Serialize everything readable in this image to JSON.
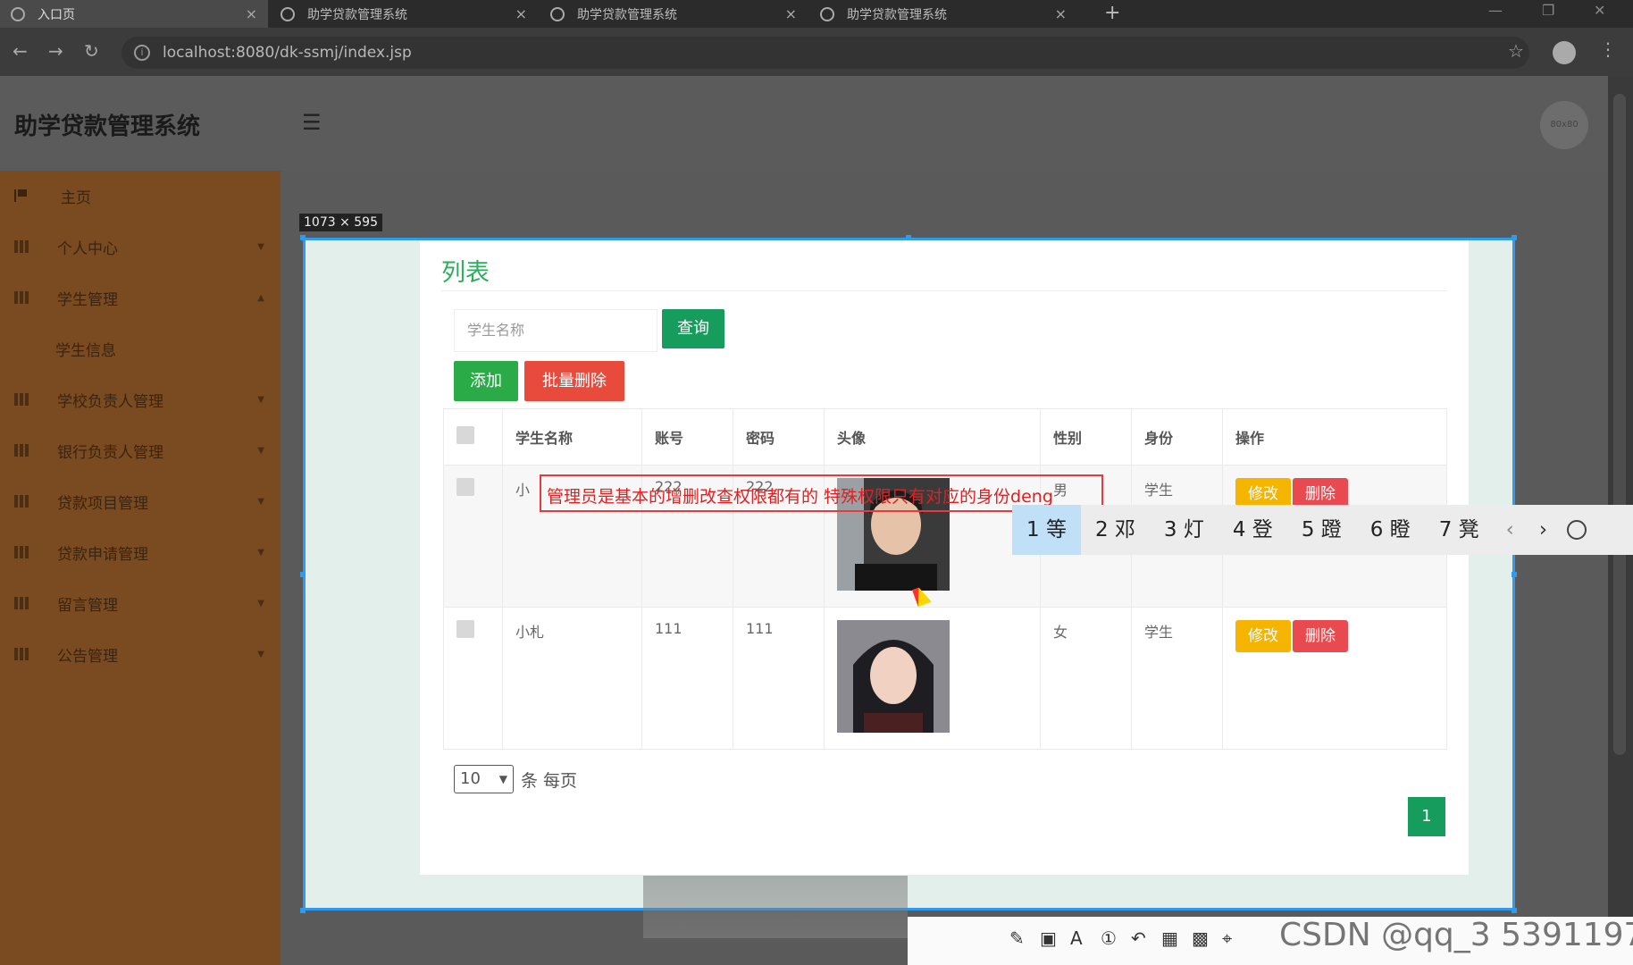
{
  "browser": {
    "tabs": [
      {
        "title": "入口页",
        "close": "×"
      },
      {
        "title": "助学贷款管理系统",
        "close": "×"
      },
      {
        "title": "助学贷款管理系统",
        "close": "×"
      },
      {
        "title": "助学贷款管理系统",
        "close": "×"
      }
    ],
    "new_tab": "+",
    "url": "localhost:8080/dk-ssmj/index.jsp"
  },
  "app": {
    "title": "助学贷款管理系统",
    "avatar_text": "80x80"
  },
  "sidebar": {
    "items": [
      {
        "label": "主页"
      },
      {
        "label": "个人中心"
      },
      {
        "label": "学生管理"
      },
      {
        "label": "学生信息"
      },
      {
        "label": "学校负责人管理"
      },
      {
        "label": "银行负责人管理"
      },
      {
        "label": "贷款项目管理"
      },
      {
        "label": "贷款申请管理"
      },
      {
        "label": "留言管理"
      },
      {
        "label": "公告管理"
      }
    ]
  },
  "capture": {
    "size_label": "1073 × 595"
  },
  "list": {
    "title": "列表",
    "search_placeholder": "学生名称",
    "query_label": "查询",
    "add_label": "添加",
    "bulk_delete_label": "批量删除",
    "columns": [
      "学生名称",
      "账号",
      "密码",
      "头像",
      "性别",
      "身份",
      "操作"
    ],
    "rows": [
      {
        "name": "小",
        "account": "222",
        "password": "222",
        "gender": "男",
        "role": "学生"
      },
      {
        "name": "小札",
        "account": "111",
        "password": "111",
        "gender": "女",
        "role": "学生"
      }
    ],
    "edit_label": "修改",
    "delete_label": "删除",
    "page_size": "10",
    "per_page_text": "条 每页",
    "current_page": "1"
  },
  "annotation": {
    "text": "管理员是基本的增删改查权限都有的 特殊权限只有对应的身份deng"
  },
  "ime": {
    "candidates": [
      "1 等",
      "2 邓",
      "3 灯",
      "4 登",
      "5 蹬",
      "6 瞪",
      "7 凳"
    ]
  },
  "watermark": "CSDN @qq_3 5391197",
  "colors": {
    "primary_green": "#169c5c",
    "add_green": "#2bab48",
    "danger_red": "#e84a3c",
    "edit_yellow": "#f4b400",
    "sidebar_brown": "#7a4a20",
    "selection_blue": "#2e9bf0"
  }
}
